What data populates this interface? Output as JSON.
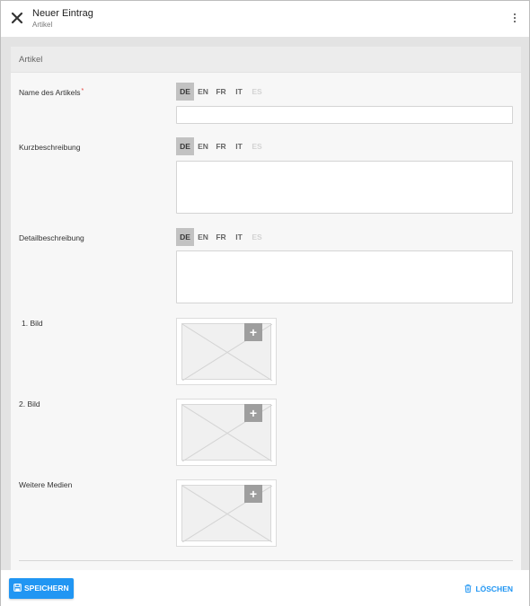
{
  "header": {
    "title": "Neuer Eintrag",
    "subtitle": "Artikel",
    "close_icon": "close-icon",
    "menu_icon": "more-vert-icon"
  },
  "card": {
    "title": "Artikel"
  },
  "languages": [
    "DE",
    "EN",
    "FR",
    "IT",
    "ES"
  ],
  "fields": {
    "name": {
      "label": "Name des Artikels",
      "required_mark": "*",
      "value": ""
    },
    "short_desc": {
      "label": "Kurzbeschreibung",
      "value": ""
    },
    "detail_desc": {
      "label": "Detailbeschreibung",
      "value": ""
    }
  },
  "media": {
    "image1": {
      "label": "1. Bild",
      "add_symbol": "+"
    },
    "image2": {
      "label": "2. Bild",
      "add_symbol": "+"
    },
    "more": {
      "label": "Weitere Medien",
      "add_symbol": "+"
    }
  },
  "footer": {
    "save_label": "SPEICHERN",
    "delete_label": "LÖSCHEN"
  },
  "colors": {
    "accent": "#2196f3",
    "active_lang_bg": "#c2c2c2",
    "disabled_lang": "#d3d3d3"
  }
}
